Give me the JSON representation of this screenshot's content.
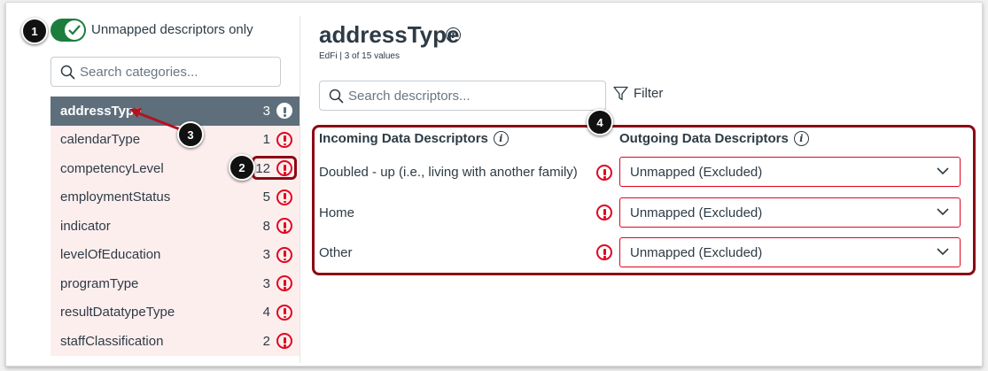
{
  "toggle": {
    "label": "Unmapped descriptors only",
    "on": true,
    "color": "#1b7e3d"
  },
  "category_search": {
    "placeholder": "Search categories..."
  },
  "categories": [
    {
      "name": "addressType",
      "count": "3",
      "active": true
    },
    {
      "name": "calendarType",
      "count": "1"
    },
    {
      "name": "competencyLevel",
      "count": "12"
    },
    {
      "name": "employmentStatus",
      "count": "5"
    },
    {
      "name": "indicator",
      "count": "8"
    },
    {
      "name": "levelOfEducation",
      "count": "3"
    },
    {
      "name": "programType",
      "count": "3"
    },
    {
      "name": "resultDatatypeType",
      "count": "4"
    },
    {
      "name": "staffClassification",
      "count": "2"
    }
  ],
  "main": {
    "title": "addressType",
    "subtitle": "EdFi  |  3 of 15 values",
    "search_placeholder": "Search descriptors...",
    "filter_label": "Filter",
    "incoming_header": "Incoming Data Descriptors",
    "outgoing_header": "Outgoing Data Descriptors",
    "rows": [
      {
        "incoming": "Doubled - up (i.e., living with another family)",
        "outgoing": "Unmapped (Excluded)"
      },
      {
        "incoming": "Home",
        "outgoing": "Unmapped (Excluded)"
      },
      {
        "incoming": "Other",
        "outgoing": "Unmapped (Excluded)"
      }
    ]
  },
  "callouts": [
    "1",
    "2",
    "3",
    "4"
  ],
  "colors": {
    "warning": "#e0061f",
    "active_row": "#5e6f7b",
    "row_bg": "#fdeeee",
    "callout_border": "#8b0a14"
  }
}
